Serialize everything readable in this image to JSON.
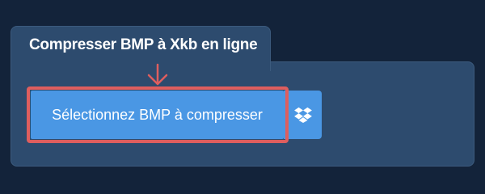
{
  "tab": {
    "title": "Compresser BMP à Xkb en ligne"
  },
  "actions": {
    "select_label": "Sélectionnez BMP à compresser",
    "dropbox_icon": "dropbox-icon"
  },
  "annotation": {
    "arrow_icon": "arrow-down-icon",
    "highlight_color": "#de5e5e"
  },
  "colors": {
    "background": "#13233a",
    "panel": "#2d4b6e",
    "button": "#4a97e4"
  }
}
